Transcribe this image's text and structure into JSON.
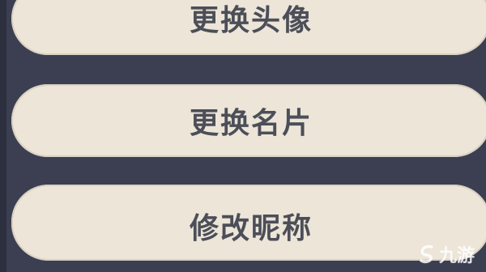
{
  "menu": {
    "items": [
      {
        "label": "更换头像"
      },
      {
        "label": "更换名片"
      },
      {
        "label": "修改昵称"
      }
    ]
  },
  "watermark": {
    "text": "九游",
    "logo_icon": "nine-game-logo-icon"
  },
  "colors": {
    "background": "#3c3f52",
    "button_fill": "#ece5d8",
    "button_text": "#4c4e58"
  }
}
